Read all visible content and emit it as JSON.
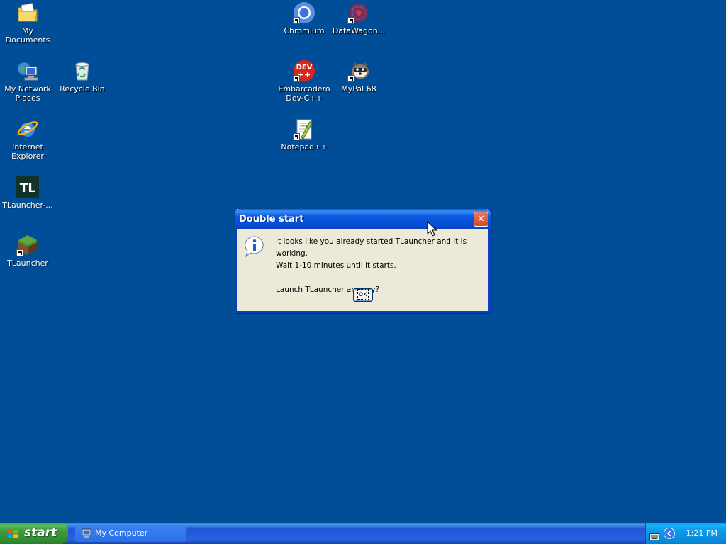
{
  "desktop": {
    "icons": {
      "my_documents": "My Documents",
      "my_network_places": "My Network\nPlaces",
      "recycle_bin": "Recycle Bin",
      "internet_explorer": "Internet\nExplorer",
      "tlauncher_installer": "TLauncher-...",
      "tlauncher": "TLauncher",
      "chromium": "Chromium",
      "datawagon": "DataWagon...",
      "embarcadero": "Embarcadero\nDev-C++",
      "mypal": "MyPal 68",
      "notepadpp": "Notepad++"
    },
    "tl_logo_text": "TL",
    "dev_logo_top": "DEV",
    "dev_logo_bottom": "++"
  },
  "dialog": {
    "title": "Double start",
    "close_glyph": "✕",
    "message_line1": "It looks like you already started TLauncher and it is working.",
    "message_line2": "Wait 1-10 minutes until it starts.",
    "message_line3": "Launch TLauncher anyway?",
    "ok_label": "ok"
  },
  "taskbar": {
    "start_label": "start",
    "task_item": "My Computer",
    "clock": "1:21 PM"
  },
  "icon_names": [
    "folder-icon",
    "network-icon",
    "recycle-bin-icon",
    "ie-icon",
    "tl-icon",
    "grass-block-icon",
    "chromium-icon",
    "datawagon-icon",
    "devcpp-icon",
    "mypal-icon",
    "notepadpp-icon",
    "info-icon",
    "keyboard-icon",
    "chevron-icon",
    "computer-icon",
    "windows-flag-icon"
  ],
  "colors": {
    "desktop": "#004e98",
    "title_bar": "#0550d8",
    "dialog_face": "#ece9d8",
    "start_green": "#3c9a3c",
    "tray_blue": "#0b9ae8"
  }
}
